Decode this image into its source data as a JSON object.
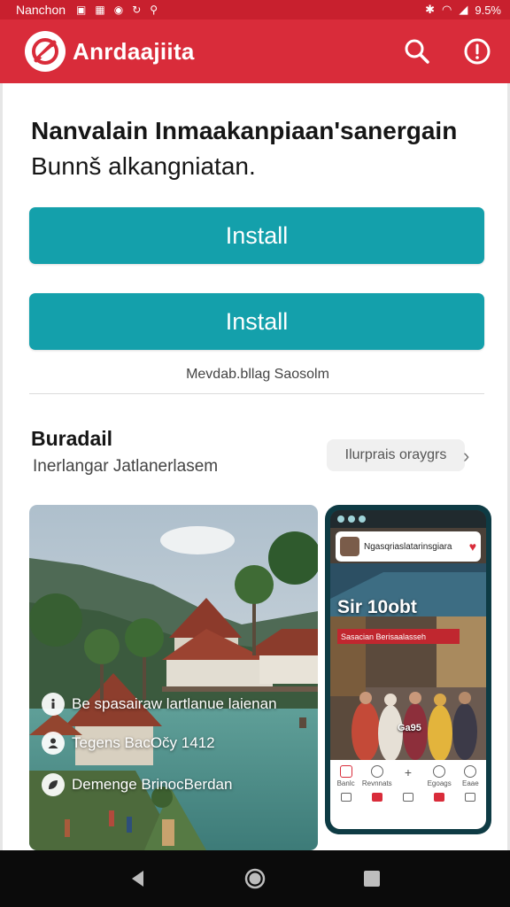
{
  "status_bar": {
    "carrier": "Nanchon",
    "battery": "9.5%"
  },
  "app_bar": {
    "title": "Anrdaajiita",
    "brand_color": "#d92c3a",
    "icons": [
      "logo-icon",
      "search-icon",
      "info-icon"
    ]
  },
  "headline": {
    "line1": "Nanvalain Inmaakanpiaan'sanergain",
    "line2": "Bunnš alkangniatan."
  },
  "buttons": {
    "install_primary": "Install",
    "install_secondary": "Install",
    "color": "#14a0ab"
  },
  "note": "Mevdab.bllag Saosolm",
  "section": {
    "title": "Buradail",
    "subtitle": "Inerlangar Jatlanerlasem",
    "chip_label": "Ilurprais oraygrs"
  },
  "photo_card": {
    "rows": [
      {
        "label": "Be spasairaw lartlanue laienan",
        "icon": "info-icon"
      },
      {
        "label": "Tegens BacOčy 1412",
        "icon": "person-icon"
      },
      {
        "label": "Demenge BrinocBerdan",
        "icon": "leaf-icon"
      }
    ]
  },
  "phone_mockup": {
    "card_text": "Ngasqriaslatarinsgiara",
    "big_text": "Sir 10obt",
    "banner_text": "Sasacian Berisaalasseh",
    "tag": "Ga95",
    "nav_items": [
      {
        "label": "Banlc",
        "icon": "home-icon",
        "active": true
      },
      {
        "label": "Revnnats",
        "icon": "search-icon",
        "active": false
      },
      {
        "label": "",
        "icon": "plus-icon",
        "active": false
      },
      {
        "label": "Egoags",
        "icon": "gift-icon",
        "active": false
      },
      {
        "label": "Eaae",
        "icon": "profile-icon",
        "active": false
      }
    ]
  },
  "system_nav": [
    "back-icon",
    "home-icon",
    "recents-icon"
  ]
}
